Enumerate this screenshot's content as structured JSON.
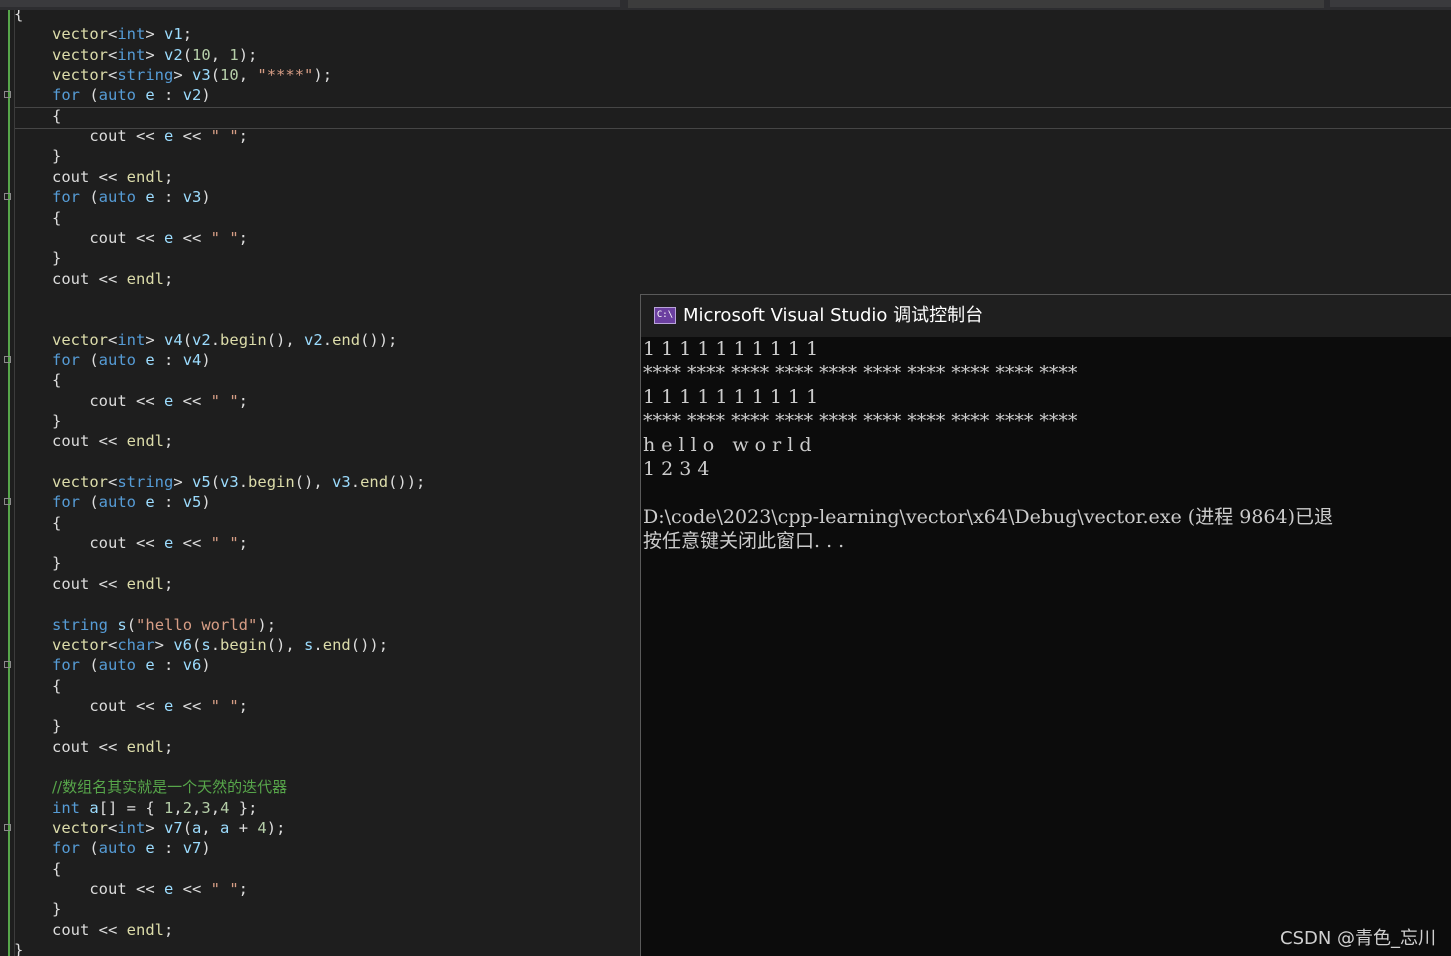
{
  "editor": {
    "lines": [
      {
        "segments": [
          {
            "t": "{",
            "c": ""
          }
        ]
      },
      {
        "segments": [
          {
            "t": "vector",
            "c": "f"
          },
          {
            "t": "<",
            "c": ""
          },
          {
            "t": "int",
            "c": "k"
          },
          {
            "t": "> ",
            "c": ""
          },
          {
            "t": "v1",
            "c": "v"
          },
          {
            "t": ";",
            "c": ""
          }
        ]
      },
      {
        "segments": [
          {
            "t": "vector",
            "c": "f"
          },
          {
            "t": "<",
            "c": ""
          },
          {
            "t": "int",
            "c": "k"
          },
          {
            "t": "> ",
            "c": ""
          },
          {
            "t": "v2",
            "c": "v"
          },
          {
            "t": "(",
            "c": ""
          },
          {
            "t": "10",
            "c": "n"
          },
          {
            "t": ", ",
            "c": ""
          },
          {
            "t": "1",
            "c": "n"
          },
          {
            "t": ");",
            "c": ""
          }
        ]
      },
      {
        "segments": [
          {
            "t": "vector",
            "c": "f"
          },
          {
            "t": "<",
            "c": ""
          },
          {
            "t": "string",
            "c": "k"
          },
          {
            "t": "> ",
            "c": ""
          },
          {
            "t": "v3",
            "c": "v"
          },
          {
            "t": "(",
            "c": ""
          },
          {
            "t": "10",
            "c": "n"
          },
          {
            "t": ", ",
            "c": ""
          },
          {
            "t": "\"****\"",
            "c": "s"
          },
          {
            "t": ");",
            "c": ""
          }
        ]
      },
      {
        "segments": [
          {
            "t": "for",
            "c": "k"
          },
          {
            "t": " (",
            "c": ""
          },
          {
            "t": "auto",
            "c": "k"
          },
          {
            "t": " ",
            "c": ""
          },
          {
            "t": "e",
            "c": "v"
          },
          {
            "t": " : ",
            "c": ""
          },
          {
            "t": "v2",
            "c": "v"
          },
          {
            "t": ")",
            "c": ""
          }
        ]
      },
      {
        "segments": [
          {
            "t": "{",
            "c": ""
          }
        ]
      },
      {
        "segments": [
          {
            "t": "    cout << ",
            "c": ""
          },
          {
            "t": "e",
            "c": "v"
          },
          {
            "t": " << ",
            "c": ""
          },
          {
            "t": "\" \"",
            "c": "s"
          },
          {
            "t": ";",
            "c": ""
          }
        ]
      },
      {
        "segments": [
          {
            "t": "}",
            "c": ""
          }
        ]
      },
      {
        "segments": [
          {
            "t": "cout << ",
            "c": ""
          },
          {
            "t": "endl",
            "c": "f"
          },
          {
            "t": ";",
            "c": ""
          }
        ]
      },
      {
        "segments": [
          {
            "t": "for",
            "c": "k"
          },
          {
            "t": " (",
            "c": ""
          },
          {
            "t": "auto",
            "c": "k"
          },
          {
            "t": " ",
            "c": ""
          },
          {
            "t": "e",
            "c": "v"
          },
          {
            "t": " : ",
            "c": ""
          },
          {
            "t": "v3",
            "c": "v"
          },
          {
            "t": ")",
            "c": ""
          }
        ]
      },
      {
        "segments": [
          {
            "t": "{",
            "c": ""
          }
        ]
      },
      {
        "segments": [
          {
            "t": "    cout << ",
            "c": ""
          },
          {
            "t": "e",
            "c": "v"
          },
          {
            "t": " << ",
            "c": ""
          },
          {
            "t": "\" \"",
            "c": "s"
          },
          {
            "t": ";",
            "c": ""
          }
        ]
      },
      {
        "segments": [
          {
            "t": "}",
            "c": ""
          }
        ]
      },
      {
        "segments": [
          {
            "t": "cout << ",
            "c": ""
          },
          {
            "t": "endl",
            "c": "f"
          },
          {
            "t": ";",
            "c": ""
          }
        ]
      },
      {
        "segments": []
      },
      {
        "segments": []
      },
      {
        "segments": [
          {
            "t": "vector",
            "c": "f"
          },
          {
            "t": "<",
            "c": ""
          },
          {
            "t": "int",
            "c": "k"
          },
          {
            "t": "> ",
            "c": ""
          },
          {
            "t": "v4",
            "c": "v"
          },
          {
            "t": "(",
            "c": ""
          },
          {
            "t": "v2",
            "c": "v"
          },
          {
            "t": ".",
            "c": ""
          },
          {
            "t": "begin",
            "c": "f"
          },
          {
            "t": "(), ",
            "c": ""
          },
          {
            "t": "v2",
            "c": "v"
          },
          {
            "t": ".",
            "c": ""
          },
          {
            "t": "end",
            "c": "f"
          },
          {
            "t": "());",
            "c": ""
          }
        ]
      },
      {
        "segments": [
          {
            "t": "for",
            "c": "k"
          },
          {
            "t": " (",
            "c": ""
          },
          {
            "t": "auto",
            "c": "k"
          },
          {
            "t": " ",
            "c": ""
          },
          {
            "t": "e",
            "c": "v"
          },
          {
            "t": " : ",
            "c": ""
          },
          {
            "t": "v4",
            "c": "v"
          },
          {
            "t": ")",
            "c": ""
          }
        ]
      },
      {
        "segments": [
          {
            "t": "{",
            "c": ""
          }
        ]
      },
      {
        "segments": [
          {
            "t": "    cout << ",
            "c": ""
          },
          {
            "t": "e",
            "c": "v"
          },
          {
            "t": " << ",
            "c": ""
          },
          {
            "t": "\" \"",
            "c": "s"
          },
          {
            "t": ";",
            "c": ""
          }
        ]
      },
      {
        "segments": [
          {
            "t": "}",
            "c": ""
          }
        ]
      },
      {
        "segments": [
          {
            "t": "cout << ",
            "c": ""
          },
          {
            "t": "endl",
            "c": "f"
          },
          {
            "t": ";",
            "c": ""
          }
        ]
      },
      {
        "segments": []
      },
      {
        "segments": [
          {
            "t": "vector",
            "c": "f"
          },
          {
            "t": "<",
            "c": ""
          },
          {
            "t": "string",
            "c": "k"
          },
          {
            "t": "> ",
            "c": ""
          },
          {
            "t": "v5",
            "c": "v"
          },
          {
            "t": "(",
            "c": ""
          },
          {
            "t": "v3",
            "c": "v"
          },
          {
            "t": ".",
            "c": ""
          },
          {
            "t": "begin",
            "c": "f"
          },
          {
            "t": "(), ",
            "c": ""
          },
          {
            "t": "v3",
            "c": "v"
          },
          {
            "t": ".",
            "c": ""
          },
          {
            "t": "end",
            "c": "f"
          },
          {
            "t": "());",
            "c": ""
          }
        ]
      },
      {
        "segments": [
          {
            "t": "for",
            "c": "k"
          },
          {
            "t": " (",
            "c": ""
          },
          {
            "t": "auto",
            "c": "k"
          },
          {
            "t": " ",
            "c": ""
          },
          {
            "t": "e",
            "c": "v"
          },
          {
            "t": " : ",
            "c": ""
          },
          {
            "t": "v5",
            "c": "v"
          },
          {
            "t": ")",
            "c": ""
          }
        ]
      },
      {
        "segments": [
          {
            "t": "{",
            "c": ""
          }
        ]
      },
      {
        "segments": [
          {
            "t": "    cout << ",
            "c": ""
          },
          {
            "t": "e",
            "c": "v"
          },
          {
            "t": " << ",
            "c": ""
          },
          {
            "t": "\" \"",
            "c": "s"
          },
          {
            "t": ";",
            "c": ""
          }
        ]
      },
      {
        "segments": [
          {
            "t": "}",
            "c": ""
          }
        ]
      },
      {
        "segments": [
          {
            "t": "cout << ",
            "c": ""
          },
          {
            "t": "endl",
            "c": "f"
          },
          {
            "t": ";",
            "c": ""
          }
        ]
      },
      {
        "segments": []
      },
      {
        "segments": [
          {
            "t": "string",
            "c": "k"
          },
          {
            "t": " ",
            "c": ""
          },
          {
            "t": "s",
            "c": "v"
          },
          {
            "t": "(",
            "c": ""
          },
          {
            "t": "\"hello world\"",
            "c": "s"
          },
          {
            "t": ");",
            "c": ""
          }
        ]
      },
      {
        "segments": [
          {
            "t": "vector",
            "c": "f"
          },
          {
            "t": "<",
            "c": ""
          },
          {
            "t": "char",
            "c": "k"
          },
          {
            "t": "> ",
            "c": ""
          },
          {
            "t": "v6",
            "c": "v"
          },
          {
            "t": "(",
            "c": ""
          },
          {
            "t": "s",
            "c": "v"
          },
          {
            "t": ".",
            "c": ""
          },
          {
            "t": "begin",
            "c": "f"
          },
          {
            "t": "(), ",
            "c": ""
          },
          {
            "t": "s",
            "c": "v"
          },
          {
            "t": ".",
            "c": ""
          },
          {
            "t": "end",
            "c": "f"
          },
          {
            "t": "());",
            "c": ""
          }
        ]
      },
      {
        "segments": [
          {
            "t": "for",
            "c": "k"
          },
          {
            "t": " (",
            "c": ""
          },
          {
            "t": "auto",
            "c": "k"
          },
          {
            "t": " ",
            "c": ""
          },
          {
            "t": "e",
            "c": "v"
          },
          {
            "t": " : ",
            "c": ""
          },
          {
            "t": "v6",
            "c": "v"
          },
          {
            "t": ")",
            "c": ""
          }
        ]
      },
      {
        "segments": [
          {
            "t": "{",
            "c": ""
          }
        ]
      },
      {
        "segments": [
          {
            "t": "    cout << ",
            "c": ""
          },
          {
            "t": "e",
            "c": "v"
          },
          {
            "t": " << ",
            "c": ""
          },
          {
            "t": "\" \"",
            "c": "s"
          },
          {
            "t": ";",
            "c": ""
          }
        ]
      },
      {
        "segments": [
          {
            "t": "}",
            "c": ""
          }
        ]
      },
      {
        "segments": [
          {
            "t": "cout << ",
            "c": ""
          },
          {
            "t": "endl",
            "c": "f"
          },
          {
            "t": ";",
            "c": ""
          }
        ]
      },
      {
        "segments": []
      },
      {
        "segments": [
          {
            "t": "//数组名其实就是一个天然的迭代器",
            "c": "c"
          }
        ]
      },
      {
        "segments": [
          {
            "t": "int",
            "c": "k"
          },
          {
            "t": " ",
            "c": ""
          },
          {
            "t": "a",
            "c": "v"
          },
          {
            "t": "[] = { ",
            "c": ""
          },
          {
            "t": "1",
            "c": "n"
          },
          {
            "t": ",",
            "c": ""
          },
          {
            "t": "2",
            "c": "n"
          },
          {
            "t": ",",
            "c": ""
          },
          {
            "t": "3",
            "c": "n"
          },
          {
            "t": ",",
            "c": ""
          },
          {
            "t": "4",
            "c": "n"
          },
          {
            "t": " };",
            "c": ""
          }
        ]
      },
      {
        "segments": [
          {
            "t": "vector",
            "c": "f"
          },
          {
            "t": "<",
            "c": ""
          },
          {
            "t": "int",
            "c": "k"
          },
          {
            "t": "> ",
            "c": ""
          },
          {
            "t": "v7",
            "c": "v"
          },
          {
            "t": "(",
            "c": ""
          },
          {
            "t": "a",
            "c": "v"
          },
          {
            "t": ", ",
            "c": ""
          },
          {
            "t": "a",
            "c": "v"
          },
          {
            "t": " + ",
            "c": ""
          },
          {
            "t": "4",
            "c": "n"
          },
          {
            "t": ");",
            "c": ""
          }
        ]
      },
      {
        "segments": [
          {
            "t": "for",
            "c": "k"
          },
          {
            "t": " (",
            "c": ""
          },
          {
            "t": "auto",
            "c": "k"
          },
          {
            "t": " ",
            "c": ""
          },
          {
            "t": "e",
            "c": "v"
          },
          {
            "t": " : ",
            "c": ""
          },
          {
            "t": "v7",
            "c": "v"
          },
          {
            "t": ")",
            "c": ""
          }
        ]
      },
      {
        "segments": [
          {
            "t": "{",
            "c": ""
          }
        ]
      },
      {
        "segments": [
          {
            "t": "    cout << ",
            "c": ""
          },
          {
            "t": "e",
            "c": "v"
          },
          {
            "t": " << ",
            "c": ""
          },
          {
            "t": "\" \"",
            "c": "s"
          },
          {
            "t": ";",
            "c": ""
          }
        ]
      },
      {
        "segments": [
          {
            "t": "}",
            "c": ""
          }
        ]
      },
      {
        "segments": [
          {
            "t": "cout << ",
            "c": ""
          },
          {
            "t": "endl",
            "c": "f"
          },
          {
            "t": ";",
            "c": ""
          }
        ]
      },
      {
        "segments": [
          {
            "t": "}",
            "c": ""
          }
        ]
      }
    ]
  },
  "console": {
    "icon_label": "C:\\",
    "title": "Microsoft Visual Studio 调试控制台",
    "output": [
      "1 1 1 1 1 1 1 1 1 1",
      "**** **** **** **** **** **** **** **** **** ****",
      "1 1 1 1 1 1 1 1 1 1",
      "**** **** **** **** **** **** **** **** **** ****",
      "h e l l o   w o r l d",
      "1 2 3 4",
      "",
      "D:\\code\\2023\\cpp-learning\\vector\\x64\\Debug\\vector.exe (进程 9864)已退",
      "按任意键关闭此窗口. . ."
    ]
  },
  "watermark": "CSDN @青色_忘川"
}
